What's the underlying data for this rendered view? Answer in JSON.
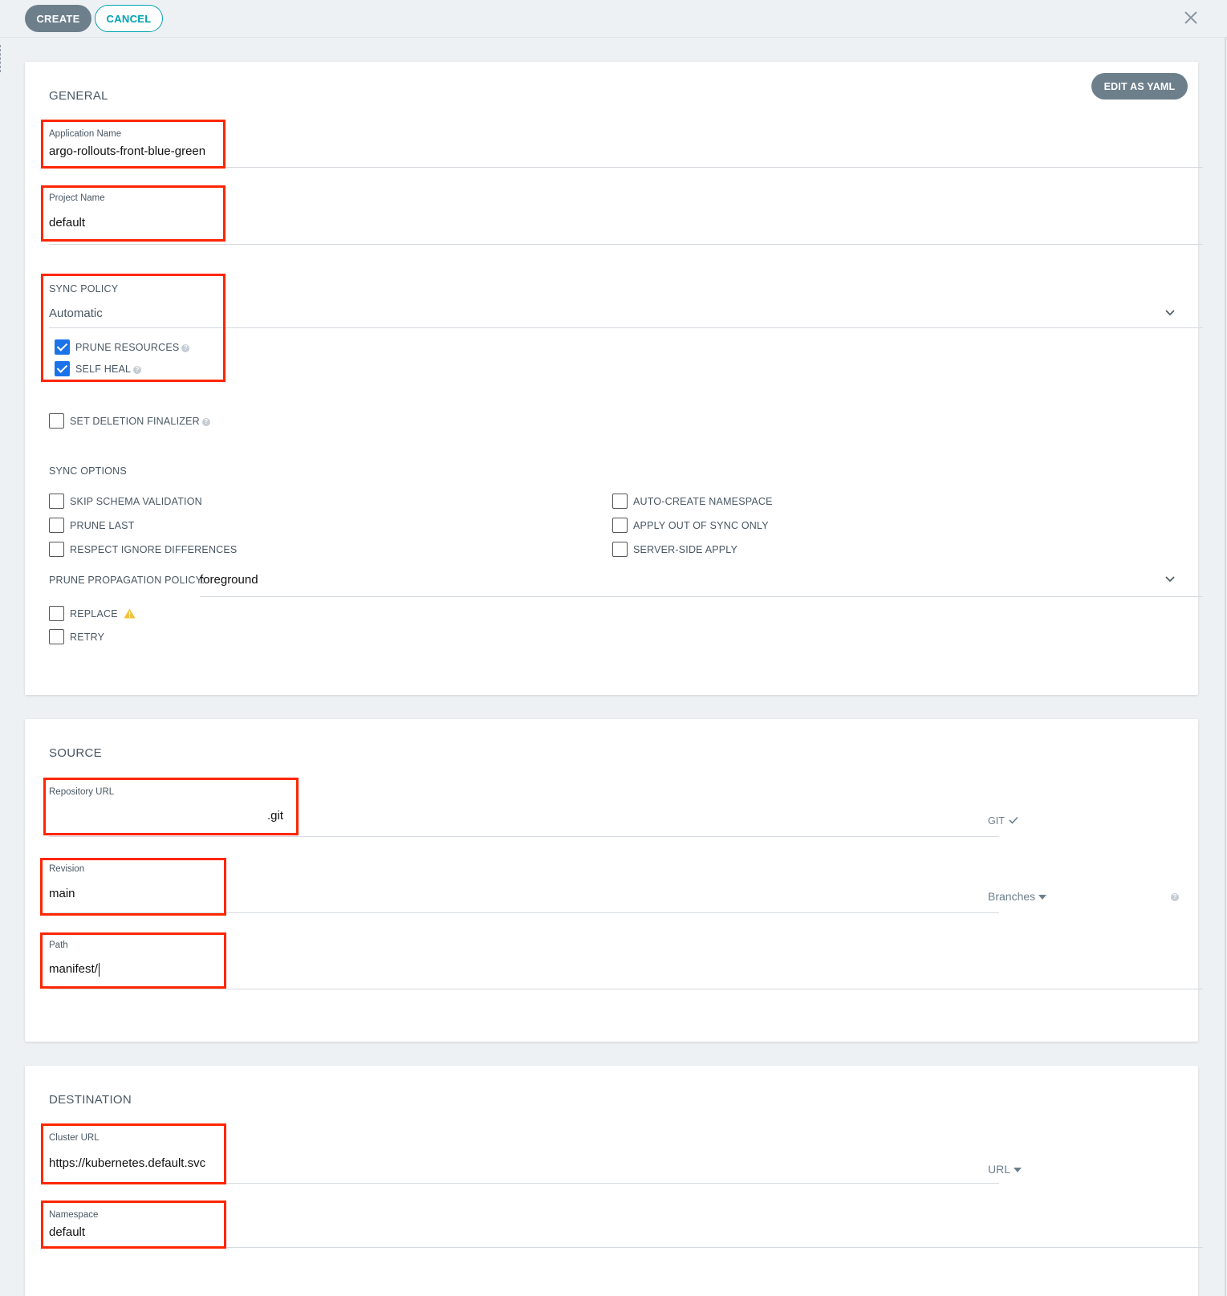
{
  "toolbar": {
    "create_label": "CREATE",
    "cancel_label": "CANCEL"
  },
  "general": {
    "title": "GENERAL",
    "edit_yaml_label": "EDIT AS YAML",
    "app_name": {
      "label": "Application Name",
      "value": "argo-rollouts-front-blue-green"
    },
    "project_name": {
      "label": "Project Name",
      "value": "default"
    },
    "sync_policy": {
      "label": "SYNC POLICY",
      "value": "Automatic",
      "prune_resources": {
        "label": "PRUNE RESOURCES",
        "checked": true
      },
      "self_heal": {
        "label": "SELF HEAL",
        "checked": true
      }
    },
    "set_deletion_finalizer": {
      "label": "SET DELETION FINALIZER",
      "checked": false
    },
    "sync_options": {
      "title": "SYNC OPTIONS",
      "left": [
        {
          "label": "SKIP SCHEMA VALIDATION",
          "checked": false
        },
        {
          "label": "PRUNE LAST",
          "checked": false
        },
        {
          "label": "RESPECT IGNORE DIFFERENCES",
          "checked": false
        }
      ],
      "right": [
        {
          "label": "AUTO-CREATE NAMESPACE",
          "checked": false
        },
        {
          "label": "APPLY OUT OF SYNC ONLY",
          "checked": false
        },
        {
          "label": "SERVER-SIDE APPLY",
          "checked": false
        }
      ]
    },
    "prune_propagation": {
      "label": "PRUNE PROPAGATION POLICY:",
      "value": "foreground"
    },
    "replace": {
      "label": "REPLACE",
      "checked": false
    },
    "retry": {
      "label": "RETRY",
      "checked": false
    }
  },
  "source": {
    "title": "SOURCE",
    "repo_url": {
      "label": "Repository URL",
      "value": ".git",
      "type": "GIT"
    },
    "revision": {
      "label": "Revision",
      "value": "main",
      "selector": "Branches"
    },
    "path": {
      "label": "Path",
      "value": "manifest/"
    }
  },
  "destination": {
    "title": "DESTINATION",
    "cluster_url": {
      "label": "Cluster URL",
      "value": "https://kubernetes.default.svc",
      "selector": "URL"
    },
    "namespace": {
      "label": "Namespace",
      "value": "default"
    }
  },
  "colors": {
    "highlight": "#ff2600",
    "accent": "#00a2b3",
    "button": "#6d7f8b",
    "checkbox": "#1a73e8",
    "warning": "#f4c030"
  },
  "icons": [
    "close-icon",
    "chevron-down-icon",
    "help-icon",
    "warning-icon",
    "check-icon",
    "caret-down-icon"
  ]
}
